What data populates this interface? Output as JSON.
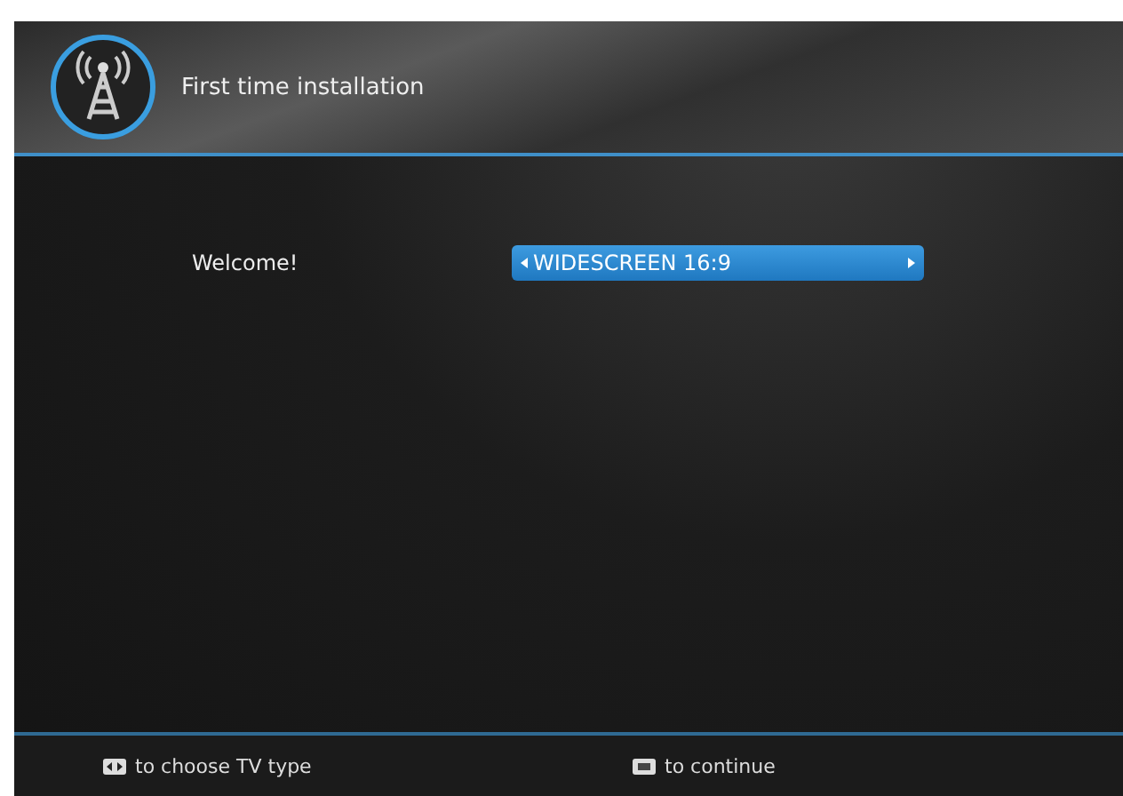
{
  "header": {
    "title": "First time installation"
  },
  "setting": {
    "label": "Welcome!",
    "value": "WIDESCREEN 16:9"
  },
  "footer_hints": [
    {
      "kind": "arrows",
      "text": "to choose TV type"
    },
    {
      "kind": "ok",
      "text": "to continue"
    }
  ]
}
